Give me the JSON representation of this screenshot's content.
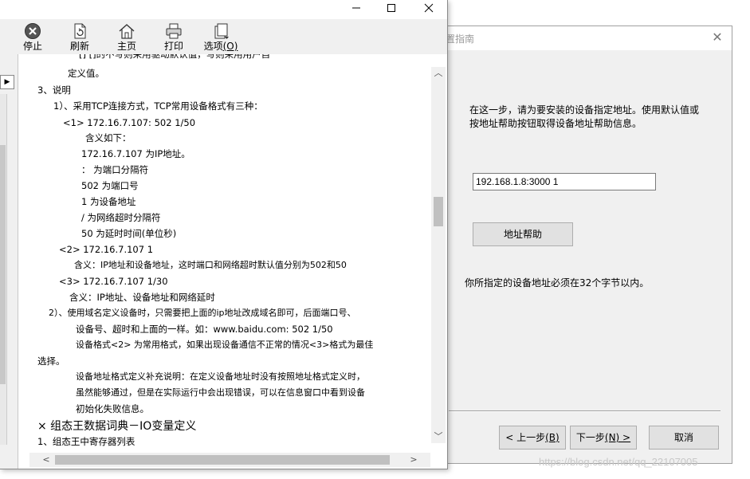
{
  "wizard": {
    "title": "置指南",
    "description": "在这一步，请为要安装的设备指定地址。使用默认值或按地址帮助按钮取得设备地址帮助信息。",
    "address_value": "192.168.1.8:3000 1",
    "address_help_label": "地址帮助",
    "note": "你所指定的设备地址必须在32个字节以内。",
    "prev_label": "< 上一步",
    "prev_hotkey": "(B)",
    "next_label": "下一步",
    "next_hotkey": "(N) >",
    "cancel_label": "取消"
  },
  "help_window": {
    "toolbar": {
      "stop": "停止",
      "refresh": "刷新",
      "home": "主页",
      "print": "打印",
      "options": "选项",
      "options_hotkey": "(O)"
    },
    "content_lines": [
      "[]                        []的不写则采用驱动默认值，写则采用用户自",
      "定义值。",
      "3、说明",
      "1）、采用TCP连接方式，TCP常用设备格式有三种：",
      "<1> 172.16.7.107: 502 1/50",
      "含义如下：",
      "172.16.7.107 为IP地址。",
      "：  为端口分隔符",
      "502 为端口号",
      "1 为设备地址",
      "/ 为网络超时分隔符",
      "50 为延时时间(单位秒)",
      "<2> 172.16.7.107 1",
      "含义：IP地址和设备地址，这时端口和网络超时默认值分别为502和50",
      "<3> 172.16.7.107 1/30",
      "含义：IP地址、设备地址和网络延时",
      "2）、使用域名定义设备时，只需要把上面的ip地址改成域名即可，后面端口号、",
      "设备号、超时和上面的一样。如：www.baidu.com: 502 1/50",
      "设备格式<2> 为常用格式，如果出现设备通信不正常的情况<3>格式为最佳",
      "选择。",
      "设备地址格式定义补充说明：在定义设备地址时没有按照地址格式定义时，",
      "虽然能够通过，但是在实际运行中会出现错误，可以在信息窗口中看到设备",
      "初始化失败信息。",
      "× 组态王数据词典－IO变量定义",
      "1、组态王中寄存器列表"
    ]
  },
  "watermark": "https://blog.csdn.net/qq_22107005"
}
